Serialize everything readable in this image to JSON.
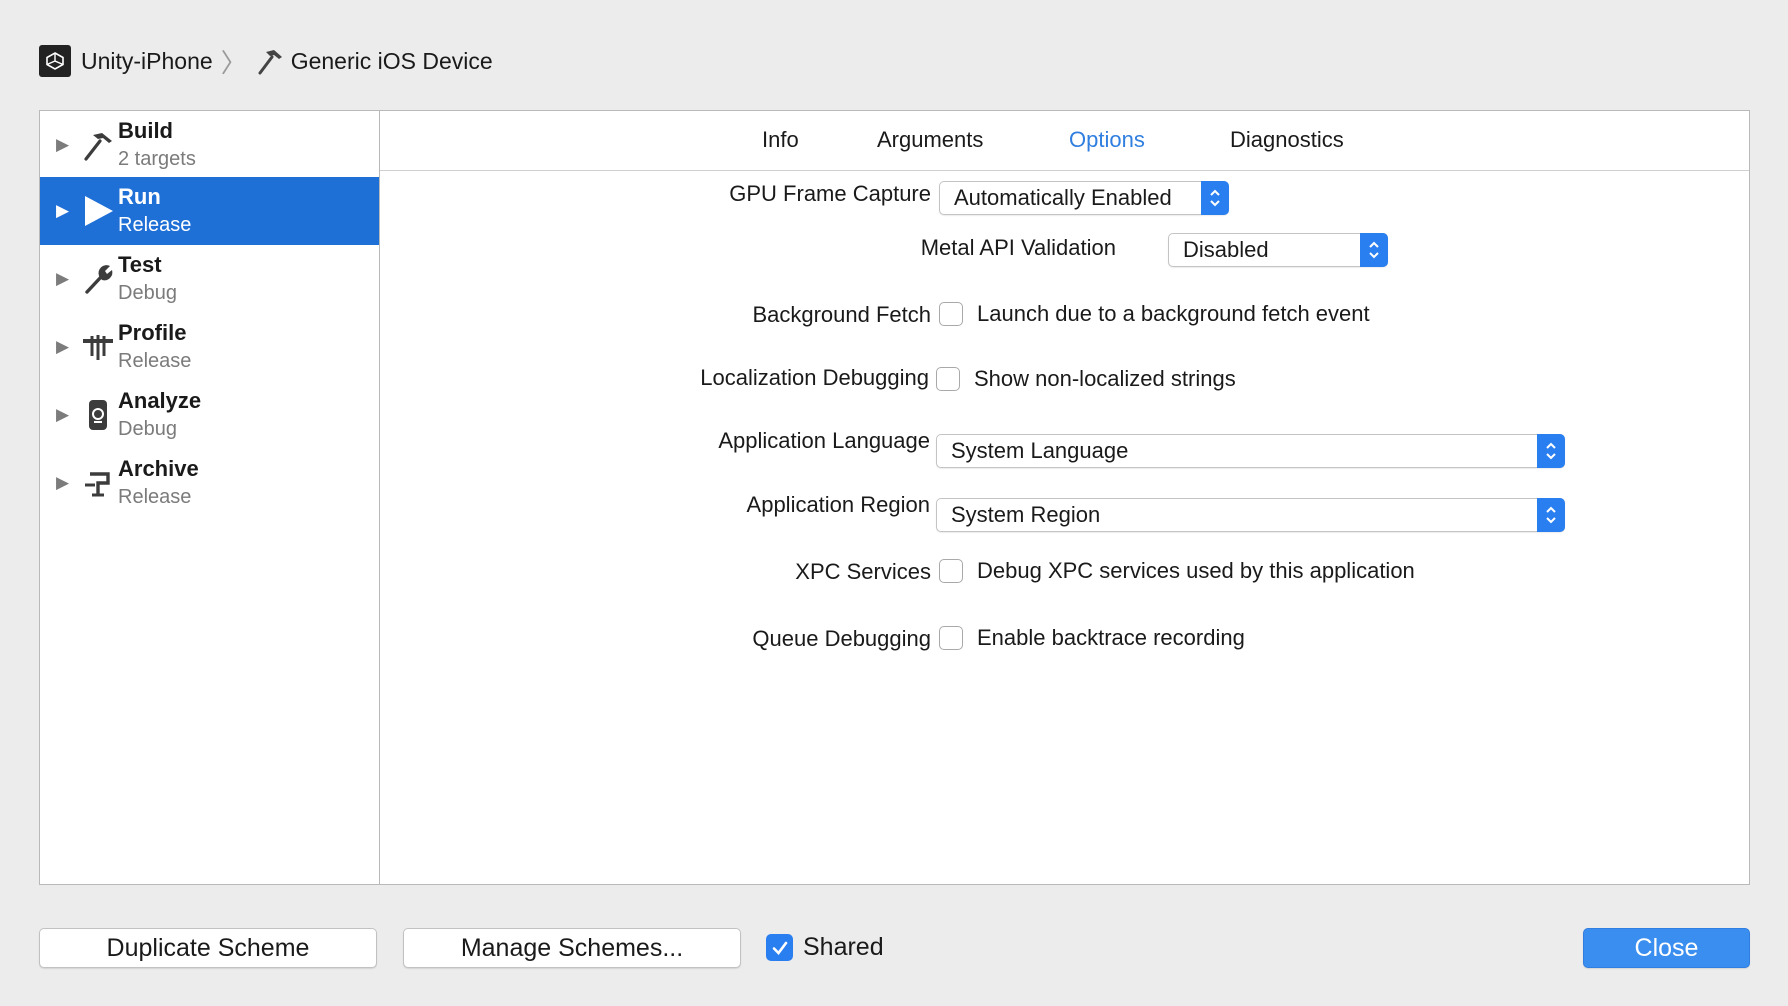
{
  "breadcrumb": {
    "project": "Unity-iPhone",
    "separator": "〉",
    "device": "Generic iOS Device"
  },
  "sidebar": {
    "items": [
      {
        "title": "Build",
        "subtitle": "2 targets",
        "icon": "hammer-icon"
      },
      {
        "title": "Run",
        "subtitle": "Release",
        "icon": "play-icon",
        "selected": true
      },
      {
        "title": "Test",
        "subtitle": "Debug",
        "icon": "wrench-icon"
      },
      {
        "title": "Profile",
        "subtitle": "Release",
        "icon": "instruments-icon"
      },
      {
        "title": "Analyze",
        "subtitle": "Debug",
        "icon": "analyze-icon"
      },
      {
        "title": "Archive",
        "subtitle": "Release",
        "icon": "archive-icon"
      }
    ]
  },
  "tabs": {
    "info": "Info",
    "arguments": "Arguments",
    "options": "Options",
    "diagnostics": "Diagnostics",
    "active": "Options"
  },
  "options": {
    "gpu_frame_capture": {
      "label": "GPU Frame Capture",
      "value": "Automatically Enabled"
    },
    "metal_api_validation": {
      "label": "Metal API Validation",
      "value": "Disabled"
    },
    "background_fetch": {
      "label": "Background Fetch",
      "checkbox": "Launch due to a background fetch event",
      "checked": false
    },
    "localization_debugging": {
      "label": "Localization Debugging",
      "checkbox": "Show non-localized strings",
      "checked": false
    },
    "application_language": {
      "label": "Application Language",
      "value": "System Language"
    },
    "application_region": {
      "label": "Application Region",
      "value": "System Region"
    },
    "xpc_services": {
      "label": "XPC Services",
      "checkbox": "Debug XPC services used by this application",
      "checked": false
    },
    "queue_debugging": {
      "label": "Queue Debugging",
      "checkbox": "Enable backtrace recording",
      "checked": false
    }
  },
  "footer": {
    "duplicate_label": "Duplicate Scheme",
    "manage_label": "Manage Schemes...",
    "shared_label": "Shared",
    "shared_checked": true,
    "close_label": "Close"
  },
  "colors": {
    "accent": "#1e6fd6",
    "tab_active": "#2f7ee0",
    "primary_button": "#3a8ef0"
  }
}
